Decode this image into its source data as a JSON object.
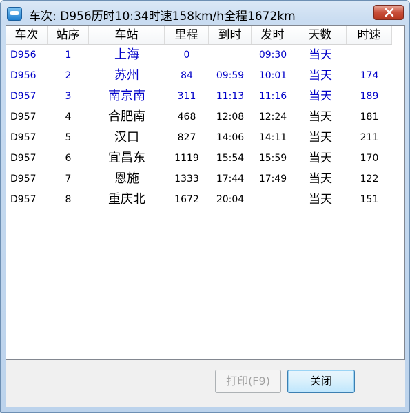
{
  "window": {
    "title": "车次: D956历时10:34时速158km/h全程1672km",
    "title_close_icon": "close-x-icon",
    "app_icon": "train-app-icon"
  },
  "colors": {
    "highlight_text": "#0000c8",
    "normal_text": "#000000"
  },
  "table": {
    "columns": [
      "车次",
      "站序",
      "车站",
      "里程",
      "到时",
      "发时",
      "天数",
      "时速"
    ],
    "rows": [
      {
        "train": "D956",
        "seq": "1",
        "station": "上海",
        "km": "0",
        "arrive": "",
        "depart": "09:30",
        "day": "当天",
        "speed": "",
        "highlight": true
      },
      {
        "train": "D956",
        "seq": "2",
        "station": "苏州",
        "km": "84",
        "arrive": "09:59",
        "depart": "10:01",
        "day": "当天",
        "speed": "174",
        "highlight": true
      },
      {
        "train": "D957",
        "seq": "3",
        "station": "南京南",
        "km": "311",
        "arrive": "11:13",
        "depart": "11:16",
        "day": "当天",
        "speed": "189",
        "highlight": true
      },
      {
        "train": "D957",
        "seq": "4",
        "station": "合肥南",
        "km": "468",
        "arrive": "12:08",
        "depart": "12:24",
        "day": "当天",
        "speed": "181",
        "highlight": false
      },
      {
        "train": "D957",
        "seq": "5",
        "station": "汉口",
        "km": "827",
        "arrive": "14:06",
        "depart": "14:11",
        "day": "当天",
        "speed": "211",
        "highlight": false
      },
      {
        "train": "D957",
        "seq": "6",
        "station": "宜昌东",
        "km": "1119",
        "arrive": "15:54",
        "depart": "15:59",
        "day": "当天",
        "speed": "170",
        "highlight": false
      },
      {
        "train": "D957",
        "seq": "7",
        "station": "恩施",
        "km": "1333",
        "arrive": "17:44",
        "depart": "17:49",
        "day": "当天",
        "speed": "122",
        "highlight": false
      },
      {
        "train": "D957",
        "seq": "8",
        "station": "重庆北",
        "km": "1672",
        "arrive": "20:04",
        "depart": "",
        "day": "当天",
        "speed": "151",
        "highlight": false
      }
    ]
  },
  "buttons": {
    "print_label": "打印(F9)",
    "print_enabled": false,
    "close_label": "关闭"
  }
}
